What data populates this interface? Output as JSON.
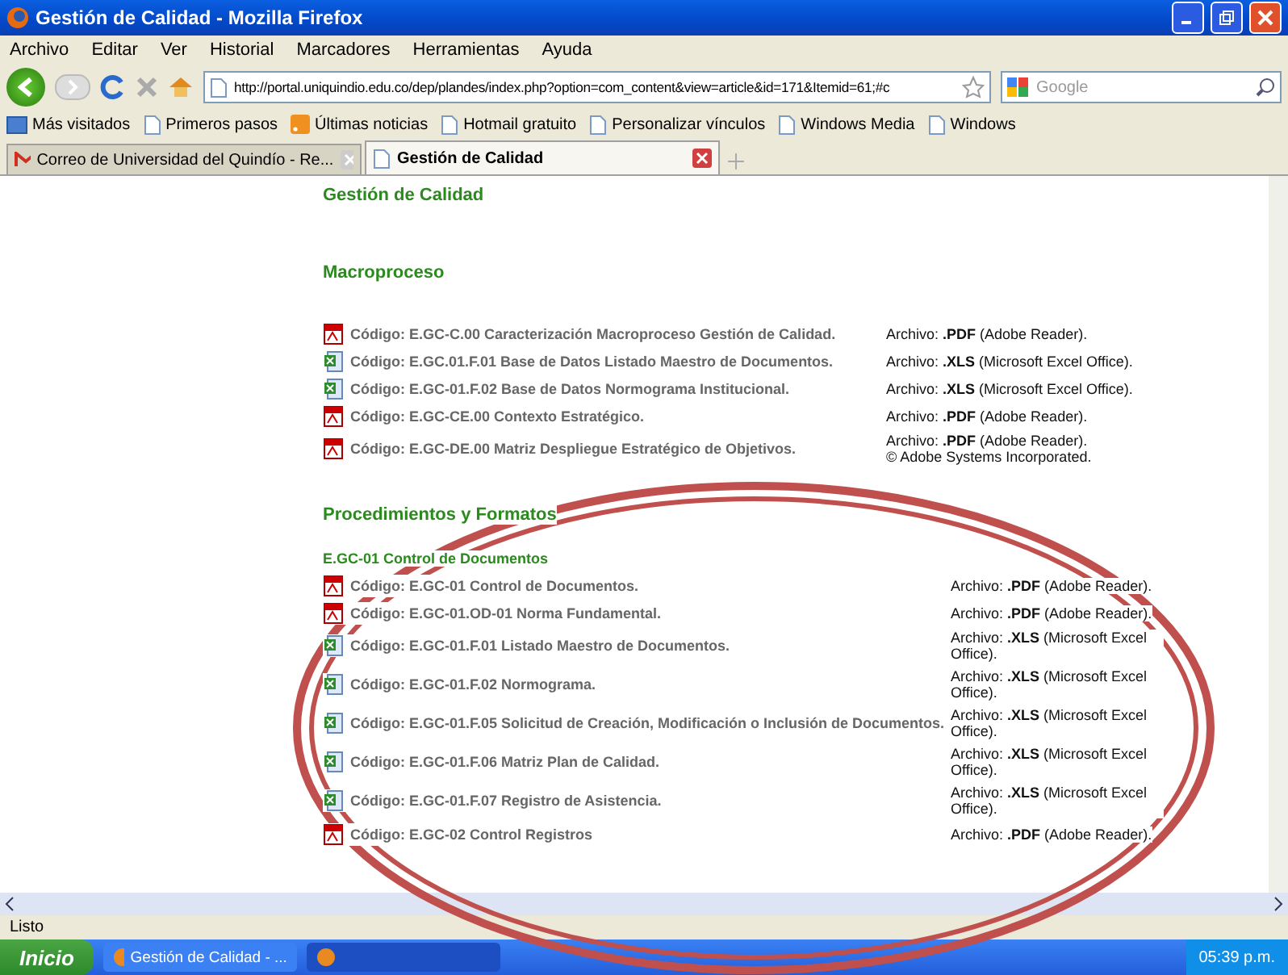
{
  "window": {
    "title": "Gestión de Calidad - Mozilla Firefox"
  },
  "menu": [
    "Archivo",
    "Editar",
    "Ver",
    "Historial",
    "Marcadores",
    "Herramientas",
    "Ayuda"
  ],
  "address": {
    "value": "http://portal.uniquindio.edu.co/dep/plandes/index.php?option=com_content&view=article&id=171&Itemid=61;#c"
  },
  "search": {
    "placeholder": "Google"
  },
  "bookmarks": [
    {
      "kind": "folder",
      "label": "Más visitados"
    },
    {
      "kind": "page",
      "label": "Primeros pasos"
    },
    {
      "kind": "feed",
      "label": "Últimas noticias"
    },
    {
      "kind": "page",
      "label": "Hotmail gratuito"
    },
    {
      "kind": "page",
      "label": "Personalizar vínculos"
    },
    {
      "kind": "page",
      "label": "Windows Media"
    },
    {
      "kind": "page",
      "label": "Windows"
    }
  ],
  "tabs": [
    {
      "label": "Correo de Universidad del Quindío - Re...",
      "kind": "mail",
      "selected": false
    },
    {
      "label": "Gestión de Calidad",
      "kind": "page",
      "selected": true
    }
  ],
  "page": {
    "title": "Gestión de Calidad",
    "sections": [
      {
        "title": "Macroproceso",
        "items": [
          {
            "kind": "pdf",
            "label": "Código: E.GC-C.00 Caracterización Macroproceso Gestión de Calidad.",
            "file": "Archivo: **.PDF** (Adobe Reader)."
          },
          {
            "kind": "xls",
            "label": "Código: E.GC.01.F.01  Base de Datos Listado Maestro de Documentos.",
            "file": "Archivo: **.XLS** (Microsoft Excel Office)."
          },
          {
            "kind": "xls",
            "label": "Código: E.GC-01.F.02 Base de Datos Normograma Institucional.",
            "file": "Archivo: **.XLS** (Microsoft Excel Office)."
          },
          {
            "kind": "pdf",
            "label": "Código: E.GC-CE.00 Contexto Estratégico.",
            "file": "Archivo: **.PDF** (Adobe Reader)."
          },
          {
            "kind": "pdf",
            "label": "Código: E.GC-DE.00 Matriz Despliegue Estratégico de Objetivos.",
            "file": "Archivo: **.PDF** (Adobe Reader).",
            "note": "© Adobe Systems Incorporated."
          }
        ]
      },
      {
        "title": "Procedimientos y Formatos",
        "subtitle": "E.GC-01 Control de Documentos",
        "items": [
          {
            "kind": "pdf",
            "label": "Código: E.GC-01 Control de Documentos.",
            "file": "Archivo: **.PDF** (Adobe Reader)."
          },
          {
            "kind": "pdf",
            "label": "Código: E.GC-01.OD-01 Norma Fundamental.",
            "file": "Archivo: **.PDF** (Adobe Reader)."
          },
          {
            "kind": "xls",
            "label": "Código: E.GC-01.F.01 Listado Maestro de Documentos.",
            "file": "Archivo: **.XLS** (Microsoft Excel Office)."
          },
          {
            "kind": "xls",
            "label": "Código: E.GC-01.F.02 Normograma.",
            "file": "Archivo: **.XLS** (Microsoft Excel Office)."
          },
          {
            "kind": "xls",
            "label": "Código: E.GC-01.F.05 Solicitud de Creación, Modificación o Inclusión de Documentos.",
            "file": "Archivo: **.XLS** (Microsoft Excel Office)."
          },
          {
            "kind": "xls",
            "label": "Código: E.GC-01.F.06 Matriz Plan de Calidad.",
            "file": "Archivo: **.XLS** (Microsoft Excel Office)."
          },
          {
            "kind": "xls",
            "label": "Código: E.GC-01.F.07 Registro de Asistencia.",
            "file": "Archivo: **.XLS** (Microsoft Excel Office)."
          },
          {
            "kind": "pdf",
            "label": "Código: E.GC-02 Control Registros",
            "file": "Archivo: **.PDF** (Adobe Reader)."
          }
        ]
      }
    ]
  },
  "annotation": {
    "kind": "ellipse"
  },
  "status_bar": {
    "text": "Listo"
  },
  "taskbar": {
    "start": "Inicio",
    "tasks": [
      {
        "label": "Gestión de Calidad - ...",
        "selected": false
      },
      {
        "selected": true
      }
    ],
    "clock": "05:39 p.m."
  }
}
